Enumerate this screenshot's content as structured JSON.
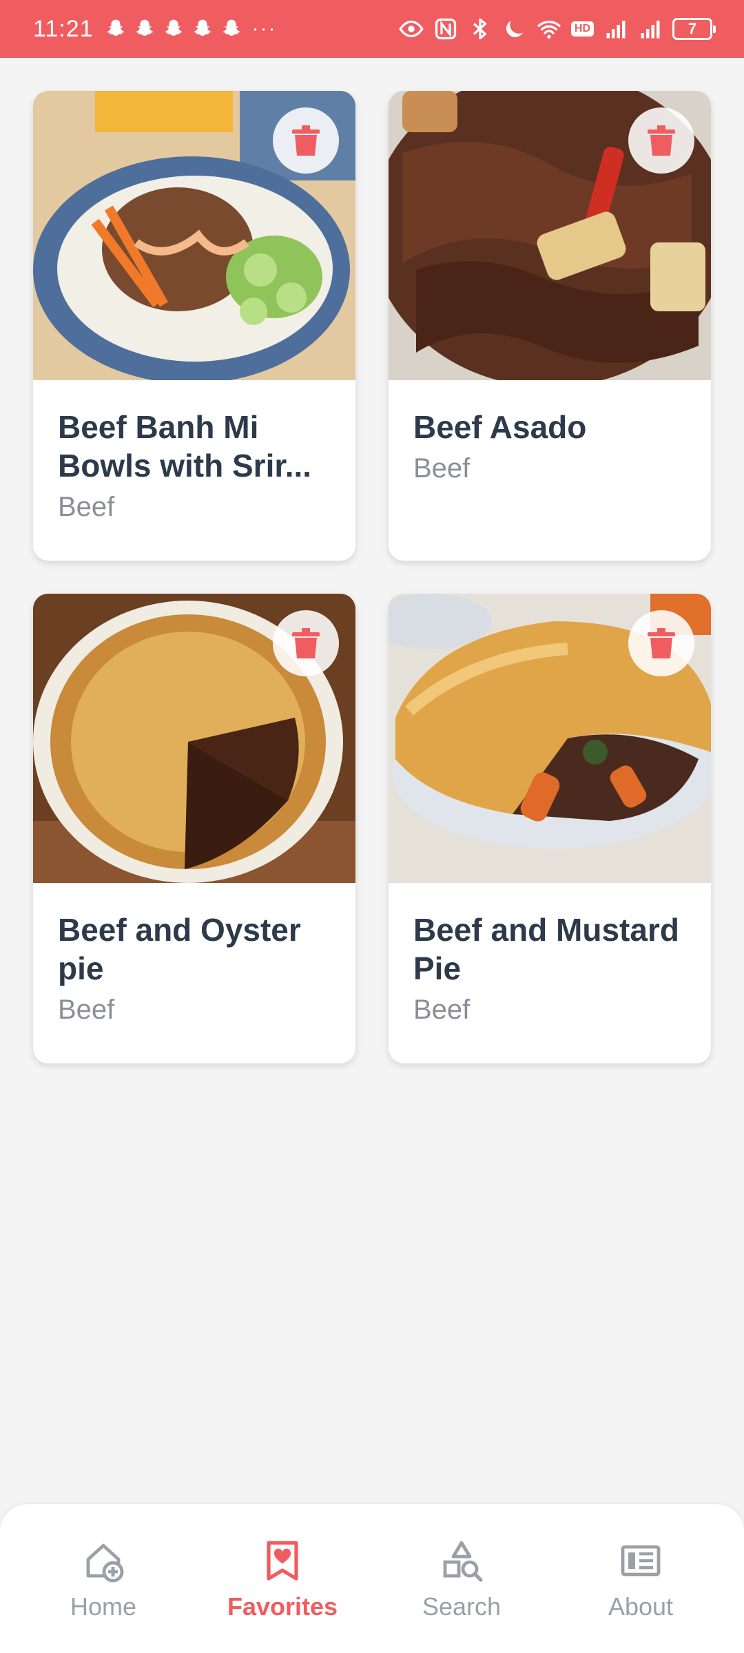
{
  "status_bar": {
    "time": "11:21",
    "dots": "···",
    "hd": "HD",
    "battery": "7"
  },
  "favorites": [
    {
      "title": "Beef Banh Mi Bowls with Srir...",
      "category": "Beef",
      "image": "beef-banh-mi-bowl-photo"
    },
    {
      "title": "Beef Asado",
      "category": "Beef",
      "image": "beef-asado-photo"
    },
    {
      "title": "Beef and Oyster pie",
      "category": "Beef",
      "image": "beef-oyster-pie-photo"
    },
    {
      "title": "Beef and Mustard Pie",
      "category": "Beef",
      "image": "beef-mustard-pie-photo"
    }
  ],
  "nav": {
    "items": [
      {
        "label": "Home",
        "icon": "home-add-icon",
        "active": false
      },
      {
        "label": "Favorites",
        "icon": "bookmark-heart-icon",
        "active": true
      },
      {
        "label": "Search",
        "icon": "shapes-search-icon",
        "active": false
      },
      {
        "label": "About",
        "icon": "newspaper-icon",
        "active": false
      }
    ]
  },
  "colors": {
    "accent": "#ef5d60",
    "title_text": "#2c3a4b",
    "muted_text": "#8a8f96",
    "background": "#f4f4f4"
  }
}
